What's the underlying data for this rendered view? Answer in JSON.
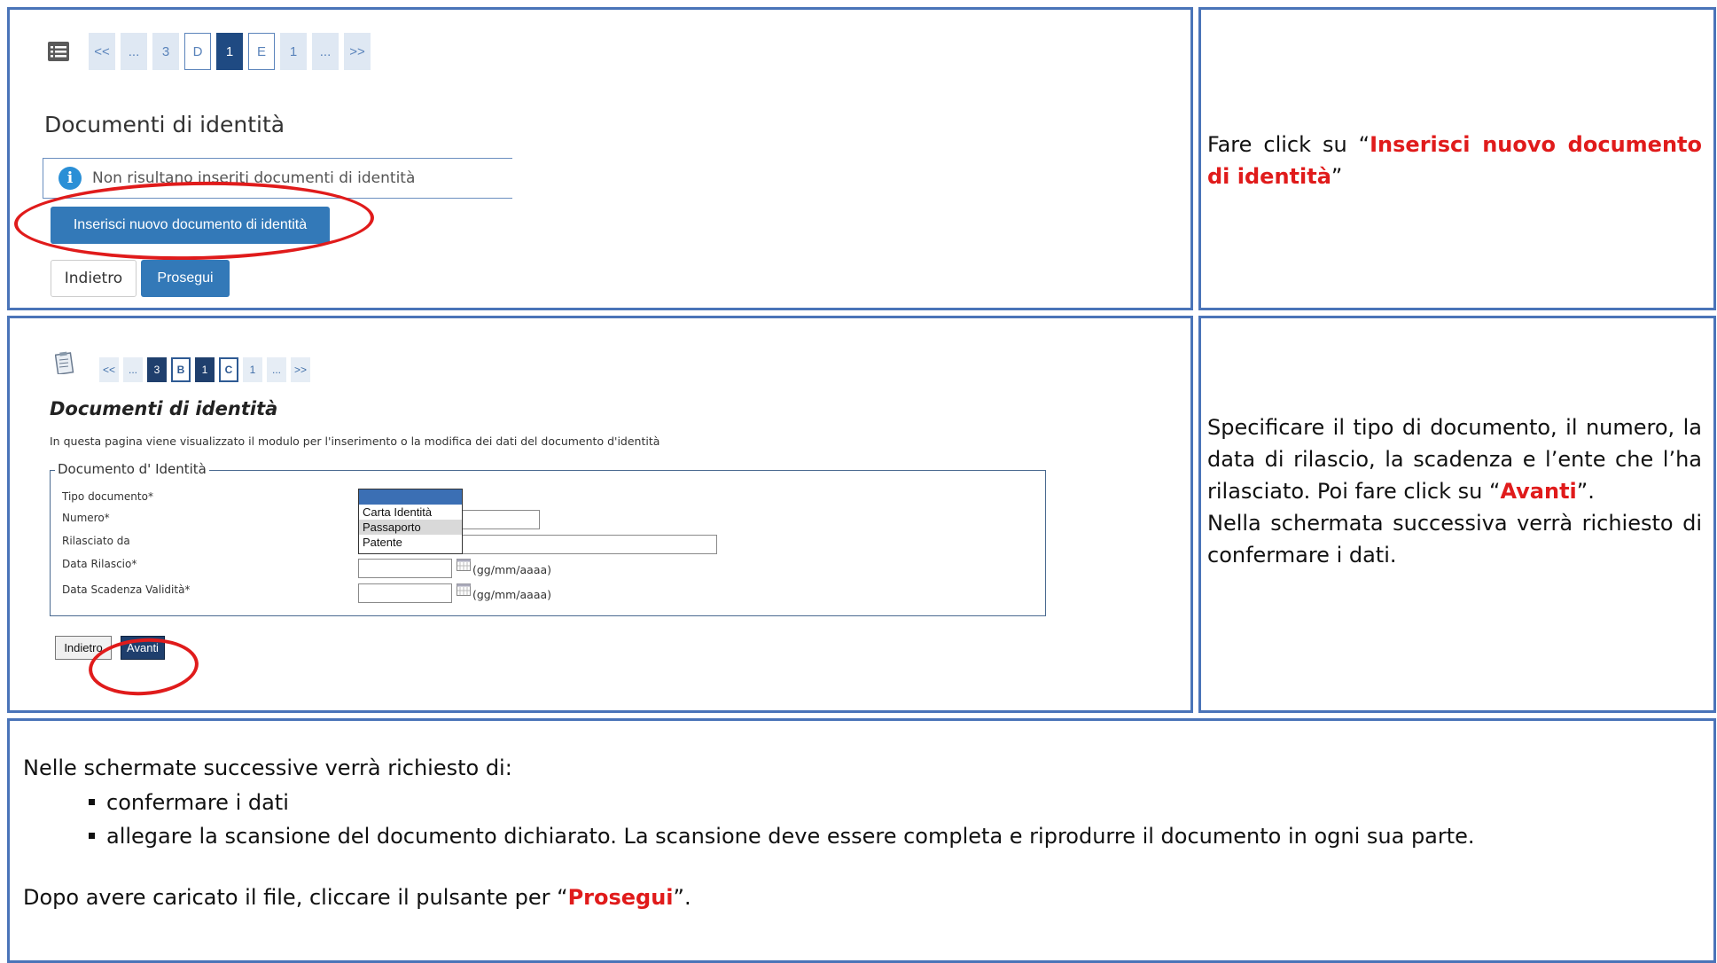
{
  "panel1": {
    "pager": [
      "<<",
      "...",
      "3",
      "D",
      "1",
      "E",
      "1",
      "...",
      ">>"
    ],
    "title": "Documenti di identità",
    "info": "Non risultano inseriti documenti di identità",
    "btn_new": "Inserisci nuovo documento di identità",
    "btn_back": "Indietro",
    "btn_next": "Prosegui"
  },
  "instr1": {
    "pre": "Fare click su “",
    "highlight": "Inserisci nuovo documento di identità",
    "post": "”"
  },
  "panel2": {
    "pager": [
      "<<",
      "...",
      "3",
      "B",
      "1",
      "C",
      "1",
      "...",
      ">>"
    ],
    "title": "Documenti di identità",
    "description": "In questa pagina viene visualizzato il modulo per l'inserimento o la modifica dei dati del documento d'identità",
    "legend": "Documento d' Identità",
    "labels": {
      "tipo": "Tipo documento*",
      "numero": "Numero*",
      "rilasciato": "Rilasciato da",
      "data_rilascio": "Data Rilascio*",
      "data_scadenza": "Data Scadenza Validità*"
    },
    "options": [
      "",
      "Carta Identità",
      "Passaporto",
      "Patente"
    ],
    "date_format": "(gg/mm/aaaa)",
    "btn_back": "Indietro",
    "btn_next": "Avanti"
  },
  "instr2": {
    "text": "Specificare il tipo di documento, il numero, la data di rilascio, la scadenza e l’ente che l’ha rilasciato. Poi fare click su “",
    "highlight": "Avanti",
    "post": "”.",
    "line2": "Nella schermata successiva verrà richiesto di confermare i dati."
  },
  "bottom": {
    "intro": "Nelle schermate successive verrà richiesto di:",
    "items": [
      "confermare i dati",
      "allegare la scansione del documento dichiarato. La scansione deve essere completa e riprodurre il documento in ogni sua parte."
    ],
    "final_pre": "Dopo avere caricato il file, cliccare il pulsante per “",
    "final_highlight": "Prosegui",
    "final_post": "”."
  },
  "colors": {
    "border": "#4a74b8",
    "accent_red": "#e01b1b",
    "button_blue": "#3379b8",
    "pager_dark": "#1f4a82"
  }
}
